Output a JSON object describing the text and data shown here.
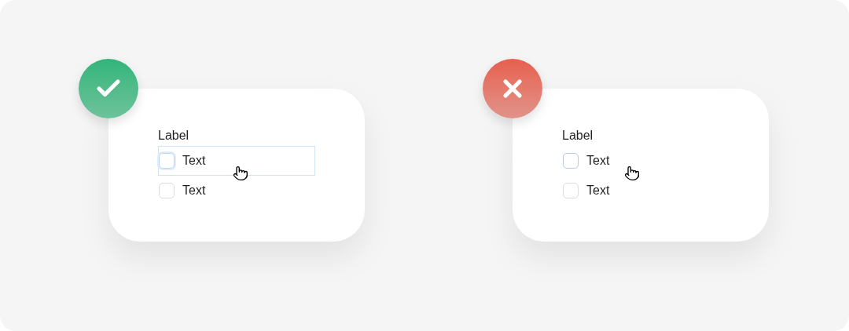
{
  "examples": [
    {
      "kind": "do",
      "label": "Label",
      "options": [
        {
          "text": "Text",
          "hovered": true,
          "checked": false
        },
        {
          "text": "Text",
          "hovered": false,
          "checked": false
        }
      ]
    },
    {
      "kind": "dont",
      "label": "Label",
      "options": [
        {
          "text": "Text",
          "hovered": true,
          "checked": false
        },
        {
          "text": "Text",
          "hovered": false,
          "checked": false
        }
      ]
    }
  ]
}
